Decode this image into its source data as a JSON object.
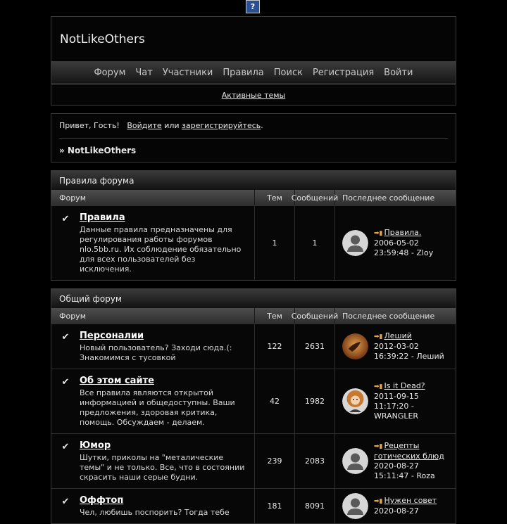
{
  "top_icon_glyph": "?",
  "site": {
    "title": "NotLikeOthers"
  },
  "nav": {
    "items": [
      "Форум",
      "Чат",
      "Участники",
      "Правила",
      "Поиск",
      "Регистрация",
      "Войти"
    ]
  },
  "active_topics": "Активные темы",
  "welcome": {
    "greeting": "Привет, Гость!",
    "login_link": "Войдите",
    "or": "или",
    "register_link": "зарегистрируйтесь",
    "dot": ".",
    "breadcrumb": "» NotLikeOthers"
  },
  "columns": {
    "forum": "Форум",
    "topics": "Тем",
    "messages": "Сообщений",
    "last": "Последнее сообщение"
  },
  "categories": [
    {
      "title": "Правила форума",
      "forums": [
        {
          "name": "Правила",
          "desc": "Данные правила предназначены для регулирования работы форумов nlo.5bb.ru. Их соблюдение обязательно для всех пользователей без исключения.",
          "topics": "1",
          "messages": "1",
          "last_title": "Правила.",
          "last_date": "2006-05-02",
          "last_by": "23:59:48 - Zloy",
          "avatar": "default"
        }
      ]
    },
    {
      "title": "Общий форум",
      "forums": [
        {
          "name": "Персоналии",
          "desc": "Новый пользователь? Заходи сюда.(: Знакомимся с тусовкой",
          "topics": "122",
          "messages": "2631",
          "last_title": "Леший",
          "last_date": "2012-03-02",
          "last_by": "16:39:22 - Леший",
          "avatar": "orange"
        },
        {
          "name": "Об этом сайте",
          "desc": "Все правила являются открытой информацией и общедоступны. Ваши предложения, здоровая критика, помощь. Обсуждаем - делаем.",
          "topics": "42",
          "messages": "1982",
          "last_title": "Is it Dead?",
          "last_date": "2011-09-15",
          "last_by": "11:17:20 - WRANGLER",
          "avatar": "face"
        },
        {
          "name": "Юмор",
          "desc": "Шутки, приколы на \"металические темы\" и не только. Все, что в состоянии скрасить наши серые будни.",
          "topics": "239",
          "messages": "2083",
          "last_title": "Рецепты готических блюд",
          "last_date": "2020-08-27",
          "last_by": "15:11:47 - Roza",
          "avatar": "default"
        },
        {
          "name": "Оффтоп",
          "desc": "Чел, любишь поспорить? Тогда тебе",
          "topics": "181",
          "messages": "8091",
          "last_title": "Нужен совет",
          "last_date": "2020-08-27",
          "last_by": "",
          "avatar": "default"
        }
      ]
    }
  ],
  "colors": {
    "background": "#000000",
    "panel": "#070707",
    "border": "#3a3a3a",
    "text": "#e8e8e8",
    "post_icon": "#e8a73a",
    "top_icon": "#2a4f95"
  }
}
